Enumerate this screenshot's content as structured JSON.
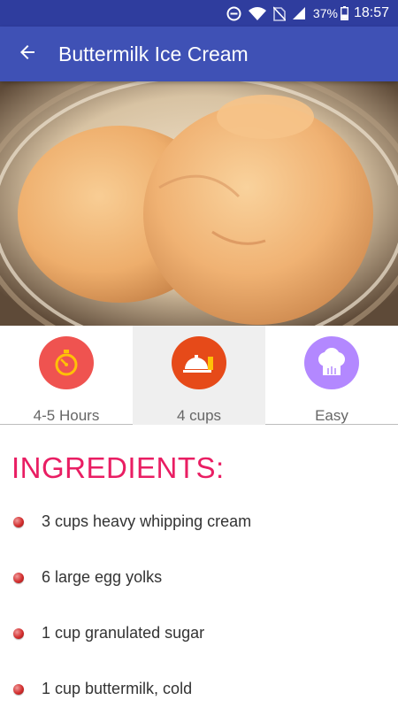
{
  "status_bar": {
    "battery": "37%",
    "time": "18:57",
    "icons": [
      "dnd-icon",
      "wifi-icon",
      "no-sim-icon",
      "signal-icon",
      "battery-icon"
    ]
  },
  "app_bar": {
    "title": "Buttermilk Ice Cream",
    "back_icon": "arrow-back-icon",
    "color": "#3f51b5"
  },
  "hero": {
    "image": "ice-cream-photo"
  },
  "stats": [
    {
      "label": "4-5 Hours",
      "icon": "stopwatch-icon",
      "color": "#ef5350"
    },
    {
      "label": "4 cups",
      "icon": "serving-dish-icon",
      "color": "#e64a19",
      "selected": true
    },
    {
      "label": "Easy",
      "icon": "chef-hat-icon",
      "color": "#b388ff"
    }
  ],
  "ingredients_section": {
    "title": "INGREDIENTS:",
    "title_color": "#e91e63",
    "items": [
      "3 cups heavy whipping cream",
      "6 large egg yolks",
      "1 cup granulated sugar",
      "1 cup buttermilk, cold"
    ]
  }
}
